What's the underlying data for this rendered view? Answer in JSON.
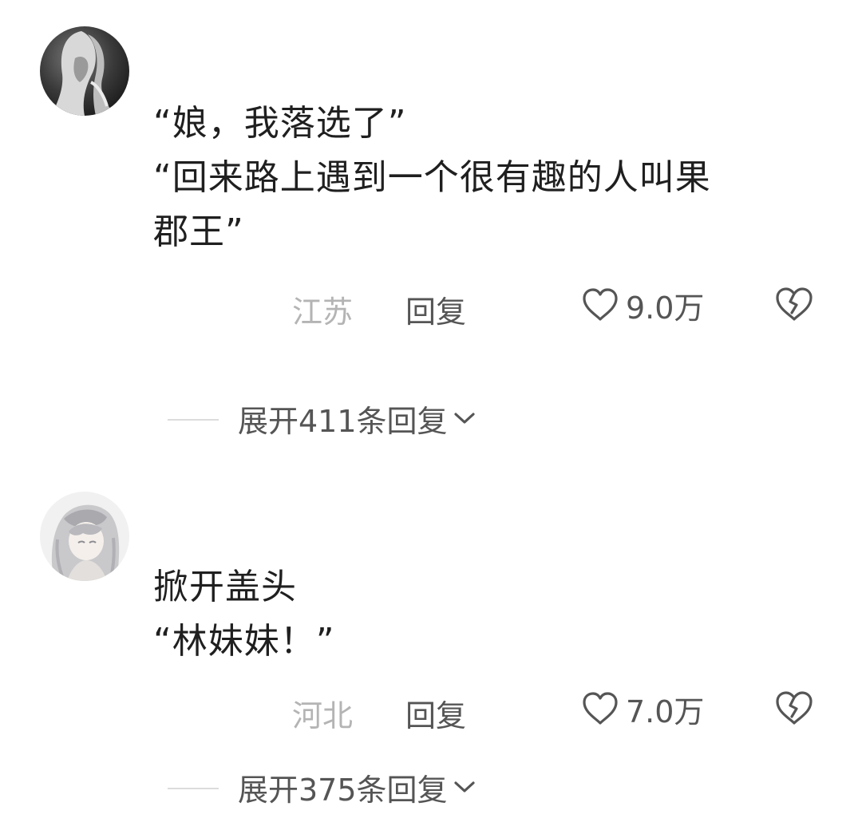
{
  "comments": [
    {
      "avatar": "grayscale-girl-avatar",
      "lines": [
        "“娘，我落选了”",
        "“回来路上遇到一个很有趣的人叫果",
        "郡王”"
      ],
      "location": "江苏",
      "reply_label": "回复",
      "likes": "9.0万",
      "expand_label": "展开411条回复"
    },
    {
      "avatar": "anime-girl-avatar",
      "lines": [
        "掀开盖头",
        "“林妹妹！”"
      ],
      "location": "河北",
      "reply_label": "回复",
      "likes": "7.0万",
      "expand_label": "展开375条回复"
    }
  ],
  "icons": {
    "like": "heart-outline-icon",
    "dislike": "broken-heart-icon",
    "expand": "chevron-down-icon"
  },
  "colors": {
    "text": "#1f1f1f",
    "meta": "#555555",
    "location": "#b4b4b4",
    "divider": "#dcdcdc"
  }
}
